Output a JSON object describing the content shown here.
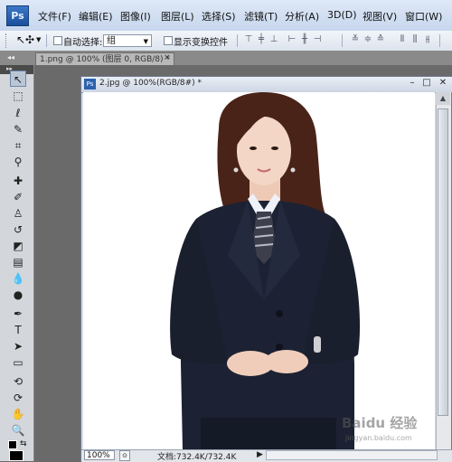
{
  "app": {
    "logo": "Ps",
    "menu": [
      "文件(F)",
      "编辑(E)",
      "图像(I)",
      "图层(L)",
      "选择(S)",
      "滤镜(T)",
      "分析(A)",
      "3D(D)",
      "视图(V)",
      "窗口(W)"
    ]
  },
  "options": {
    "auto_select_label": "自动选择:",
    "auto_select_value": "组",
    "show_transform_label": "显示变换控件"
  },
  "tabs": {
    "background_doc": "1.png @ 100% (图层 0, RGB/8) *"
  },
  "document": {
    "title": "2.jpg @ 100%(RGB/8#) *",
    "zoom": "100%",
    "doc_info": "文档:732.4K/732.4K"
  },
  "watermark": {
    "text": "Baidu 经验",
    "sub": "jingyan.baidu.com"
  },
  "colors": {
    "suit": "#1c2233",
    "hair": "#4a2318",
    "skin": "#f3d6c6",
    "accent": "#2c62ad"
  }
}
